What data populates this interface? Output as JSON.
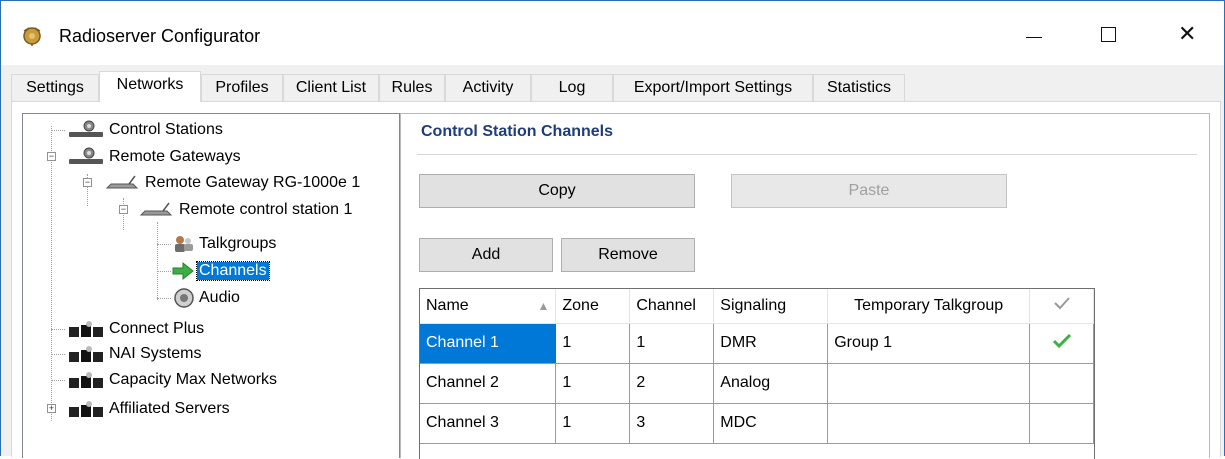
{
  "window": {
    "title": "Radioserver Configurator",
    "app_icon": "app-logo-icon",
    "controls": {
      "minimize": "minimize-icon",
      "maximize": "maximize-icon",
      "close": "close-icon",
      "close_glyph": "✕"
    }
  },
  "tabs": [
    {
      "label": "Settings",
      "active": false
    },
    {
      "label": "Networks",
      "active": true
    },
    {
      "label": "Profiles",
      "active": false
    },
    {
      "label": "Client List",
      "active": false
    },
    {
      "label": "Rules",
      "active": false
    },
    {
      "label": "Activity",
      "active": false
    },
    {
      "label": "Log",
      "active": false
    },
    {
      "label": "Export/Import Settings",
      "active": false
    },
    {
      "label": "Statistics",
      "active": false
    }
  ],
  "tree": {
    "nodes": [
      {
        "label": "Control Stations",
        "icon": "control-station-icon",
        "expander": ""
      },
      {
        "label": "Remote Gateways",
        "icon": "control-station-icon",
        "expander": "−"
      },
      {
        "label": "Remote Gateway RG-1000e 1",
        "icon": "gateway-icon",
        "expander": "−"
      },
      {
        "label": "Remote control station 1",
        "icon": "gateway-icon",
        "expander": "−"
      },
      {
        "label": "Talkgroups",
        "icon": "talkgroups-icon",
        "expander": ""
      },
      {
        "label": "Channels",
        "icon": "channels-arrow-icon",
        "expander": "",
        "selected": true
      },
      {
        "label": "Audio",
        "icon": "audio-icon",
        "expander": ""
      },
      {
        "label": "Connect Plus",
        "icon": "network-server-icon",
        "expander": ""
      },
      {
        "label": "NAI Systems",
        "icon": "network-server-icon",
        "expander": ""
      },
      {
        "label": "Capacity Max Networks",
        "icon": "network-server-icon",
        "expander": ""
      },
      {
        "label": "Affiliated Servers",
        "icon": "network-server-icon",
        "expander": "+"
      }
    ]
  },
  "panel": {
    "title": "Control Station Channels",
    "copy_label": "Copy",
    "paste_label": "Paste",
    "add_label": "Add",
    "remove_label": "Remove"
  },
  "grid": {
    "columns": [
      "Name",
      "Zone",
      "Channel",
      "Signaling",
      "Temporary Talkgroup",
      "✓"
    ],
    "sort_indicator": "▲",
    "rows": [
      {
        "name": "Channel 1",
        "zone": "1",
        "channel": "1",
        "signaling": "DMR",
        "talkgroup": "Group 1",
        "checked": true
      },
      {
        "name": "Channel 2",
        "zone": "1",
        "channel": "2",
        "signaling": "Analog",
        "talkgroup": "",
        "checked": false
      },
      {
        "name": "Channel 3",
        "zone": "1",
        "channel": "3",
        "signaling": "MDC",
        "talkgroup": "",
        "checked": false
      }
    ]
  },
  "colors": {
    "selection": "#0078d7",
    "panel_title": "#1f3d7a",
    "check_green": "#3cb043"
  }
}
